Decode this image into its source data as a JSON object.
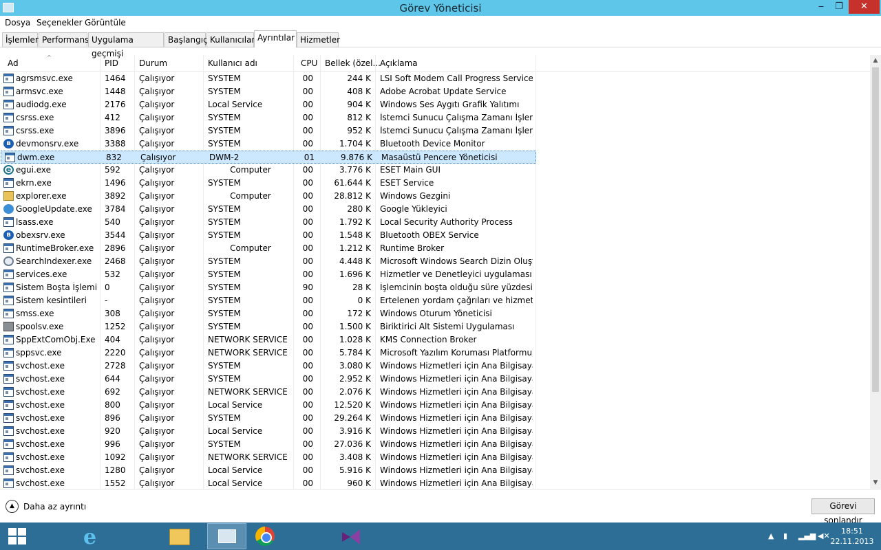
{
  "window": {
    "title": "Görev Yöneticisi",
    "minimize": "‒",
    "maximize": "❐",
    "close": "✕"
  },
  "menu": [
    "Dosya",
    "Seçenekler",
    "Görüntüle"
  ],
  "tabs": [
    "İşlemler",
    "Performans",
    "Uygulama geçmişi",
    "Başlangıç",
    "Kullanıcılar",
    "Ayrıntılar",
    "Hizmetler"
  ],
  "active_tab": "Ayrıntılar",
  "columns": {
    "name": "Ad",
    "pid": "PID",
    "status": "Durum",
    "user": "Kullanıcı adı",
    "cpu": "CPU",
    "memory": "Bellek (özel...",
    "description": "Açıklama"
  },
  "processes": [
    {
      "icon": "app",
      "name": "agrsmsvc.exe",
      "pid": "1464",
      "status": "Çalışıyor",
      "user": "SYSTEM",
      "cpu": "00",
      "memory": "244 K",
      "description": "LSI Soft Modem Call Progress Service"
    },
    {
      "icon": "window",
      "name": "armsvc.exe",
      "pid": "1448",
      "status": "Çalışıyor",
      "user": "SYSTEM",
      "cpu": "00",
      "memory": "408 K",
      "description": "Adobe Acrobat Update Service"
    },
    {
      "icon": "app",
      "name": "audiodg.exe",
      "pid": "2176",
      "status": "Çalışıyor",
      "user": "Local Service",
      "cpu": "00",
      "memory": "904 K",
      "description": "Windows Ses Aygıtı Grafik Yalıtımı"
    },
    {
      "icon": "app",
      "name": "csrss.exe",
      "pid": "412",
      "status": "Çalışıyor",
      "user": "SYSTEM",
      "cpu": "00",
      "memory": "812 K",
      "description": "İstemci Sunucu Çalışma Zamanı İşlemi"
    },
    {
      "icon": "app",
      "name": "csrss.exe",
      "pid": "3896",
      "status": "Çalışıyor",
      "user": "SYSTEM",
      "cpu": "00",
      "memory": "952 K",
      "description": "İstemci Sunucu Çalışma Zamanı İşlemi"
    },
    {
      "icon": "bluetooth",
      "name": "devmonsrv.exe",
      "pid": "3388",
      "status": "Çalışıyor",
      "user": "SYSTEM",
      "cpu": "00",
      "memory": "1.704 K",
      "description": "Bluetooth Device Monitor"
    },
    {
      "icon": "app",
      "name": "dwm.exe",
      "pid": "832",
      "status": "Çalışıyor",
      "user": "DWM-2",
      "cpu": "01",
      "memory": "9.876 K",
      "description": "Masaüstü Pencere Yöneticisi",
      "selected": true
    },
    {
      "icon": "eset",
      "name": "egui.exe",
      "pid": "592",
      "status": "Çalışıyor",
      "user": "Computer",
      "user_centered": true,
      "cpu": "00",
      "memory": "3.776 K",
      "description": "ESET Main GUI"
    },
    {
      "icon": "app",
      "name": "ekrn.exe",
      "pid": "1496",
      "status": "Çalışıyor",
      "user": "SYSTEM",
      "cpu": "00",
      "memory": "61.644 K",
      "description": "ESET Service"
    },
    {
      "icon": "folder",
      "name": "explorer.exe",
      "pid": "3892",
      "status": "Çalışıyor",
      "user": "Computer",
      "user_centered": true,
      "cpu": "00",
      "memory": "28.812 K",
      "description": "Windows Gezgini"
    },
    {
      "icon": "ring",
      "name": "GoogleUpdate.exe",
      "pid": "3784",
      "status": "Çalışıyor",
      "user": "SYSTEM",
      "cpu": "00",
      "memory": "280 K",
      "description": "Google Yükleyici"
    },
    {
      "icon": "app",
      "name": "lsass.exe",
      "pid": "540",
      "status": "Çalışıyor",
      "user": "SYSTEM",
      "cpu": "00",
      "memory": "1.792 K",
      "description": "Local Security Authority Process"
    },
    {
      "icon": "bluetooth",
      "name": "obexsrv.exe",
      "pid": "3544",
      "status": "Çalışıyor",
      "user": "SYSTEM",
      "cpu": "00",
      "memory": "1.548 K",
      "description": "Bluetooth OBEX Service"
    },
    {
      "icon": "app",
      "name": "RuntimeBroker.exe",
      "pid": "2896",
      "status": "Çalışıyor",
      "user": "Computer",
      "user_centered": true,
      "cpu": "00",
      "memory": "1.212 K",
      "description": "Runtime Broker"
    },
    {
      "icon": "search",
      "name": "SearchIndexer.exe",
      "pid": "2468",
      "status": "Çalışıyor",
      "user": "SYSTEM",
      "cpu": "00",
      "memory": "4.448 K",
      "description": "Microsoft Windows Search Dizin Oluştu..."
    },
    {
      "icon": "app",
      "name": "services.exe",
      "pid": "532",
      "status": "Çalışıyor",
      "user": "SYSTEM",
      "cpu": "00",
      "memory": "1.696 K",
      "description": "Hizmetler ve Denetleyici uygulaması"
    },
    {
      "icon": "app",
      "name": "Sistem Boşta İşlemi",
      "pid": "0",
      "status": "Çalışıyor",
      "user": "SYSTEM",
      "cpu": "90",
      "memory": "28 K",
      "description": "İşlemcinin boşta olduğu süre yüzdesi"
    },
    {
      "icon": "app",
      "name": "Sistem kesintileri",
      "pid": "-",
      "status": "Çalışıyor",
      "user": "SYSTEM",
      "cpu": "00",
      "memory": "0 K",
      "description": "Ertelenen yordam çağrıları ve hizmet ke..."
    },
    {
      "icon": "app",
      "name": "smss.exe",
      "pid": "308",
      "status": "Çalışıyor",
      "user": "SYSTEM",
      "cpu": "00",
      "memory": "172 K",
      "description": "Windows Oturum Yöneticisi"
    },
    {
      "icon": "printer",
      "name": "spoolsv.exe",
      "pid": "1252",
      "status": "Çalışıyor",
      "user": "SYSTEM",
      "cpu": "00",
      "memory": "1.500 K",
      "description": "Biriktirici Alt Sistemi Uygulaması"
    },
    {
      "icon": "app",
      "name": "SppExtComObj.Exe",
      "pid": "404",
      "status": "Çalışıyor",
      "user": "NETWORK SERVICE",
      "cpu": "00",
      "memory": "1.028 K",
      "description": "KMS Connection Broker"
    },
    {
      "icon": "app",
      "name": "sppsvc.exe",
      "pid": "2220",
      "status": "Çalışıyor",
      "user": "NETWORK SERVICE",
      "cpu": "00",
      "memory": "5.784 K",
      "description": "Microsoft Yazılım Koruması Platformu ..."
    },
    {
      "icon": "app",
      "name": "svchost.exe",
      "pid": "2728",
      "status": "Çalışıyor",
      "user": "SYSTEM",
      "cpu": "00",
      "memory": "3.080 K",
      "description": "Windows Hizmetleri için Ana Bilgisayar ..."
    },
    {
      "icon": "app",
      "name": "svchost.exe",
      "pid": "644",
      "status": "Çalışıyor",
      "user": "SYSTEM",
      "cpu": "00",
      "memory": "2.952 K",
      "description": "Windows Hizmetleri için Ana Bilgisayar ..."
    },
    {
      "icon": "app",
      "name": "svchost.exe",
      "pid": "692",
      "status": "Çalışıyor",
      "user": "NETWORK SERVICE",
      "cpu": "00",
      "memory": "2.076 K",
      "description": "Windows Hizmetleri için Ana Bilgisayar ..."
    },
    {
      "icon": "app",
      "name": "svchost.exe",
      "pid": "800",
      "status": "Çalışıyor",
      "user": "Local Service",
      "cpu": "00",
      "memory": "12.520 K",
      "description": "Windows Hizmetleri için Ana Bilgisayar ..."
    },
    {
      "icon": "app",
      "name": "svchost.exe",
      "pid": "896",
      "status": "Çalışıyor",
      "user": "SYSTEM",
      "cpu": "00",
      "memory": "29.264 K",
      "description": "Windows Hizmetleri için Ana Bilgisayar ..."
    },
    {
      "icon": "app",
      "name": "svchost.exe",
      "pid": "920",
      "status": "Çalışıyor",
      "user": "Local Service",
      "cpu": "00",
      "memory": "3.916 K",
      "description": "Windows Hizmetleri için Ana Bilgisayar ..."
    },
    {
      "icon": "app",
      "name": "svchost.exe",
      "pid": "996",
      "status": "Çalışıyor",
      "user": "SYSTEM",
      "cpu": "00",
      "memory": "27.036 K",
      "description": "Windows Hizmetleri için Ana Bilgisayar ..."
    },
    {
      "icon": "app",
      "name": "svchost.exe",
      "pid": "1092",
      "status": "Çalışıyor",
      "user": "NETWORK SERVICE",
      "cpu": "00",
      "memory": "3.408 K",
      "description": "Windows Hizmetleri için Ana Bilgisayar ..."
    },
    {
      "icon": "app",
      "name": "svchost.exe",
      "pid": "1280",
      "status": "Çalışıyor",
      "user": "Local Service",
      "cpu": "00",
      "memory": "5.916 K",
      "description": "Windows Hizmetleri için Ana Bilgisayar ..."
    },
    {
      "icon": "app",
      "name": "svchost.exe",
      "pid": "1552",
      "status": "Çalışıyor",
      "user": "Local Service",
      "cpu": "00",
      "memory": "960 K",
      "description": "Windows Hizmetleri için Ana Bilgisayar ..."
    }
  ],
  "footer": {
    "fewer_details": "Daha az ayrıntı",
    "end_task": "Görevi sonlandır"
  },
  "taskbar": {
    "clock_time": "18:51",
    "clock_date": "22.11.2013",
    "accent": "#2d6e96"
  }
}
